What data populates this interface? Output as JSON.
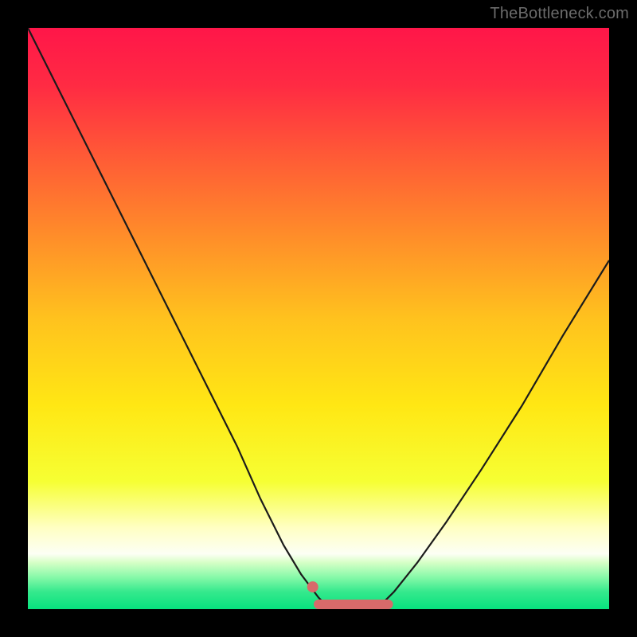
{
  "watermark": "TheBottleneck.com",
  "colors": {
    "frame": "#000000",
    "watermark": "#6b6b6b",
    "curve": "#1b1b1b",
    "marker": "#d86a6a",
    "gradient_stops": [
      {
        "offset": 0.0,
        "color": "#ff1649"
      },
      {
        "offset": 0.1,
        "color": "#ff2b43"
      },
      {
        "offset": 0.22,
        "color": "#ff5a36"
      },
      {
        "offset": 0.35,
        "color": "#ff8a2a"
      },
      {
        "offset": 0.5,
        "color": "#ffc21e"
      },
      {
        "offset": 0.65,
        "color": "#ffe714"
      },
      {
        "offset": 0.78,
        "color": "#f6ff33"
      },
      {
        "offset": 0.86,
        "color": "#ffffc3"
      },
      {
        "offset": 0.905,
        "color": "#fcfff5"
      },
      {
        "offset": 0.92,
        "color": "#d6ffc6"
      },
      {
        "offset": 0.945,
        "color": "#87f9a9"
      },
      {
        "offset": 0.97,
        "color": "#35e98d"
      },
      {
        "offset": 1.0,
        "color": "#07e27e"
      }
    ]
  },
  "chart_data": {
    "type": "line",
    "title": "",
    "xlabel": "",
    "ylabel": "",
    "xlim": [
      0,
      100
    ],
    "ylim": [
      0,
      100
    ],
    "grid": false,
    "series": [
      {
        "name": "left-curve",
        "x": [
          0,
          6,
          12,
          18,
          24,
          30,
          36,
          40,
          44,
          47,
          50,
          52
        ],
        "y": [
          100,
          88,
          76,
          64,
          52,
          40,
          28,
          19,
          11,
          6,
          2,
          0
        ]
      },
      {
        "name": "right-curve",
        "x": [
          60,
          63,
          67,
          72,
          78,
          85,
          92,
          100
        ],
        "y": [
          0,
          3,
          8,
          15,
          24,
          35,
          47,
          60
        ]
      }
    ],
    "flat_region": {
      "x_start": 50,
      "x_end": 62,
      "y": 0
    },
    "marker_dot": {
      "x": 49,
      "y": 3
    }
  }
}
